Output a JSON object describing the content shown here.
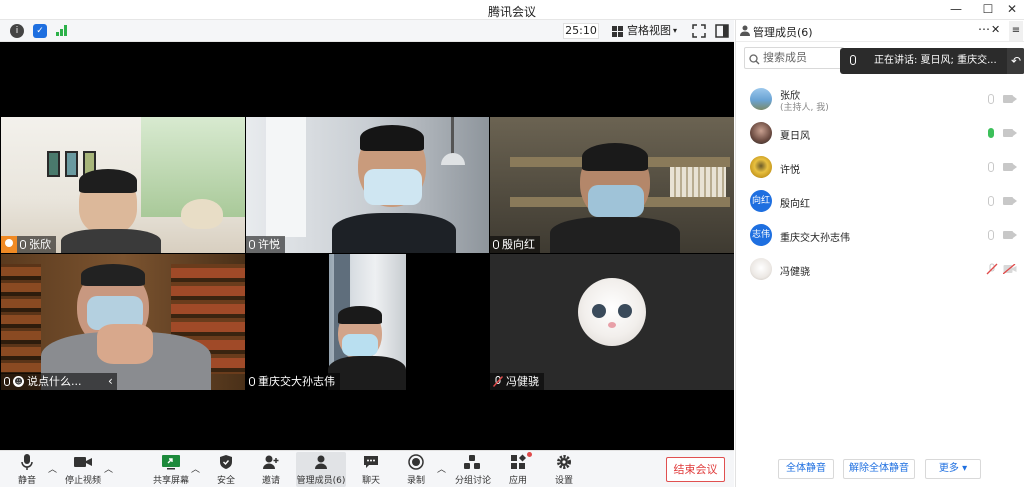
{
  "window": {
    "title": "腾讯会议"
  },
  "infobar": {
    "timer": "25:10",
    "view_label": "宫格视图"
  },
  "tiles": [
    {
      "name": "张欣",
      "host": true
    },
    {
      "name": "许悦"
    },
    {
      "name": "殷向红"
    },
    {
      "name": "说点什么..."
    },
    {
      "name": "重庆交大孙志伟"
    },
    {
      "name": "冯健骁"
    }
  ],
  "toolbar": {
    "mute": "静音",
    "stop_video": "停止视频",
    "share": "共享屏幕",
    "security": "安全",
    "invite": "邀请",
    "members": "管理成员(6)",
    "chat": "聊天",
    "record": "录制",
    "breakout": "分组讨论",
    "apps": "应用",
    "settings": "设置",
    "end": "结束会议"
  },
  "panel": {
    "title": "管理成员(6)",
    "search_placeholder": "搜索成员",
    "speaking": "正在讲话: 夏日风; 重庆交...",
    "members": [
      {
        "name": "张欣",
        "sub": "(主持人, 我)"
      },
      {
        "name": "夏日风"
      },
      {
        "name": "许悦"
      },
      {
        "name": "殷向红",
        "avatar_text": "向红"
      },
      {
        "name": "重庆交大孙志伟",
        "avatar_text": "志伟"
      },
      {
        "name": "冯健骁"
      }
    ],
    "mute_all": "全体静音",
    "unmute_all": "解除全体静音",
    "more": "更多 ▾"
  },
  "colors": {
    "accent": "#1e6fe0",
    "end_red": "#e03a3a",
    "speaking_green": "#3cc05a",
    "muted_red": "#e04a4a"
  }
}
